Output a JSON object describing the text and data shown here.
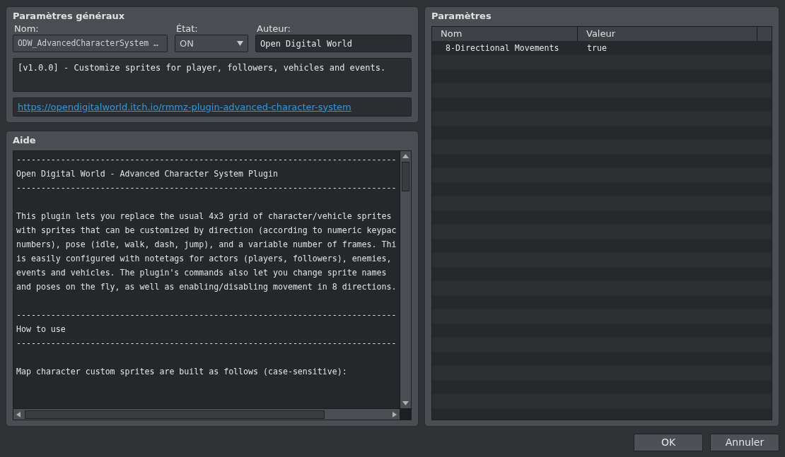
{
  "general": {
    "title": "Paramètres généraux",
    "name_label": "Nom:",
    "name_value": "ODW_AdvancedCharacterSystem …",
    "state_label": "État:",
    "state_value": "ON",
    "author_label": "Auteur:",
    "author_value": "Open Digital World",
    "description": "[v1.0.0] - Customize sprites for player, followers, vehicles and events.",
    "link": "https://opendigitalworld.itch.io/rmmz-plugin-advanced-character-system"
  },
  "help": {
    "title": "Aide",
    "paragraphs": [
      [
        "-----------------------------------------------------------------------------",
        "Open Digital World - Advanced Character System Plugin",
        "-----------------------------------------------------------------------------"
      ],
      [
        "This plugin lets you replace the usual 4x3 grid of character/vehicle sprites",
        "with sprites that can be customized by direction (according to numeric keypac",
        "numbers), pose (idle, walk, dash, jump), and a variable number of frames. Thi",
        "is easily configured with notetags for actors (players, followers), enemies,",
        "events and vehicles. The plugin's commands also let you change sprite names",
        "and poses on the fly, as well as enabling/disabling movement in 8 directions."
      ],
      [
        "-----------------------------------------------------------------------------",
        "How to use",
        "-----------------------------------------------------------------------------"
      ],
      [
        "Map character custom sprites are built as follows (case-sensitive):"
      ]
    ]
  },
  "parameters": {
    "title": "Paramètres",
    "columns": [
      "Nom",
      "Valeur"
    ],
    "rows": [
      {
        "name": "8-Directional Movements",
        "value": "true"
      }
    ]
  },
  "buttons": [
    "OK",
    "Annuler"
  ]
}
